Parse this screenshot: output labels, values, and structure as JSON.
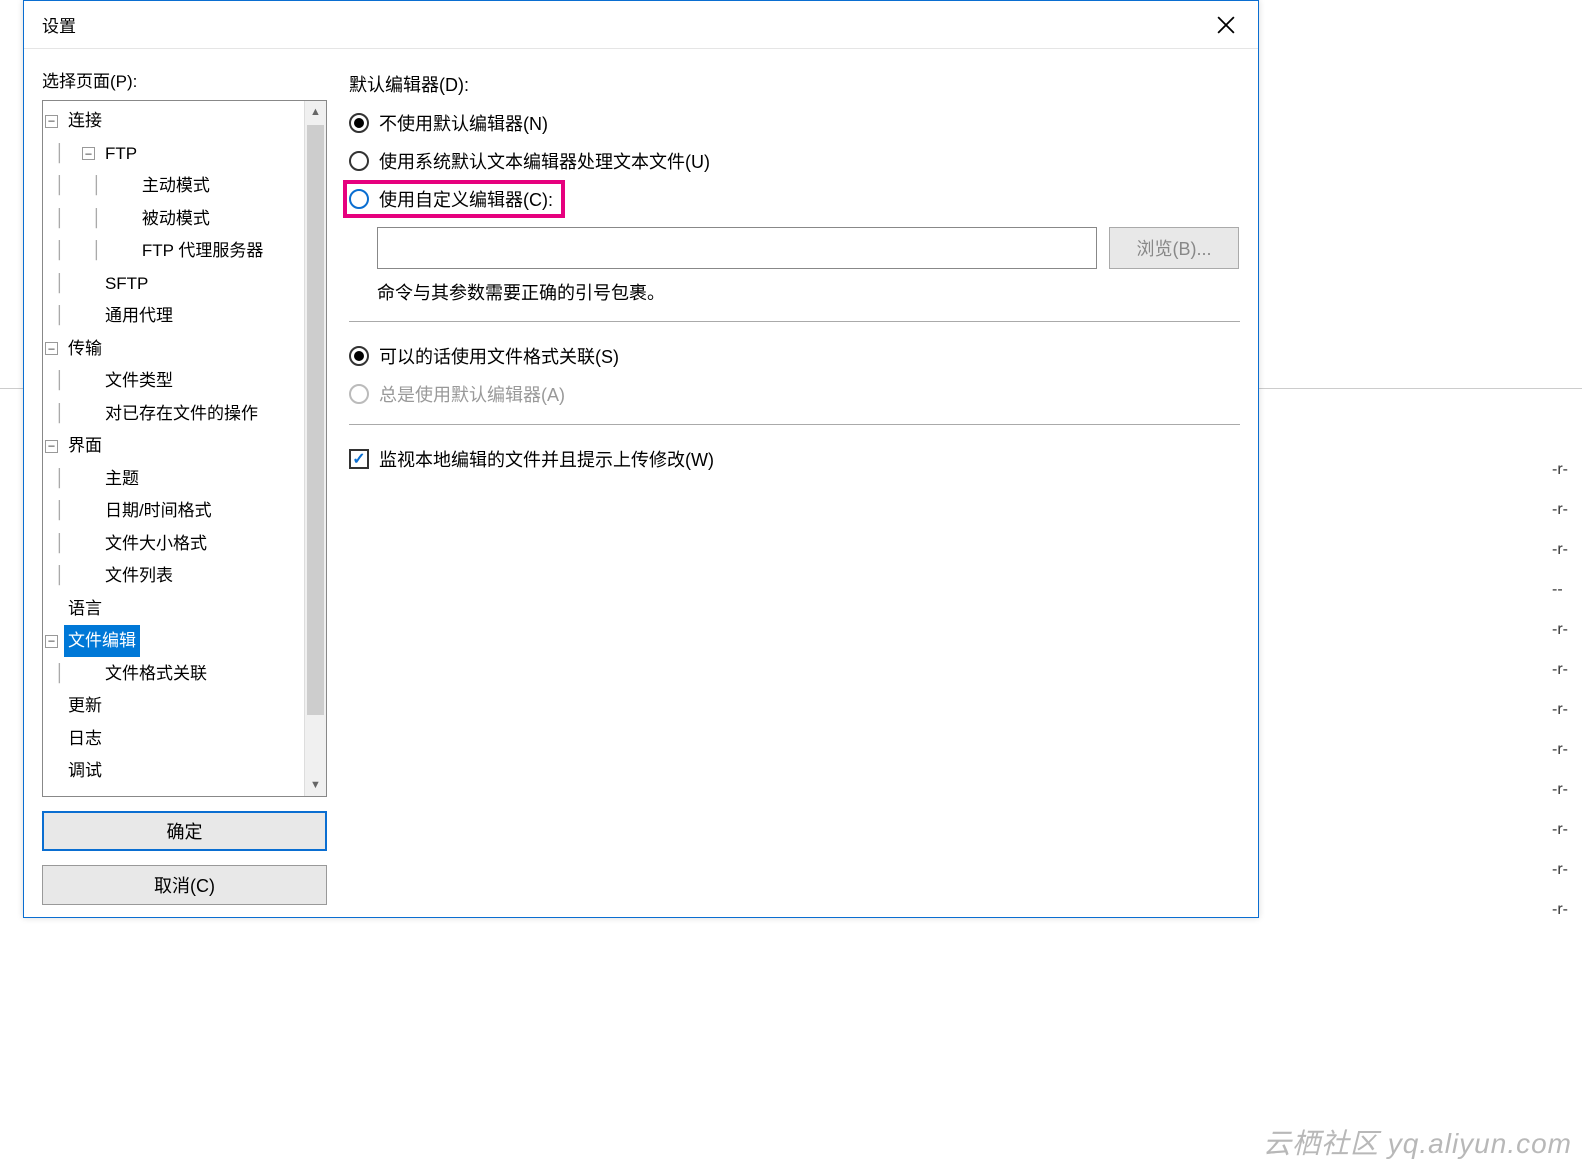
{
  "dialog": {
    "title": "设置",
    "select_page_label": "选择页面(P):",
    "ok_label": "确定",
    "cancel_label": "取消(C)"
  },
  "tree": {
    "items": [
      {
        "label": "连接",
        "depth": 0,
        "exp": "-"
      },
      {
        "label": "FTP",
        "depth": 1,
        "exp": "-"
      },
      {
        "label": "主动模式",
        "depth": 2,
        "exp": ""
      },
      {
        "label": "被动模式",
        "depth": 2,
        "exp": ""
      },
      {
        "label": "FTP 代理服务器",
        "depth": 2,
        "exp": ""
      },
      {
        "label": "SFTP",
        "depth": 1,
        "exp": ""
      },
      {
        "label": "通用代理",
        "depth": 1,
        "exp": ""
      },
      {
        "label": "传输",
        "depth": 0,
        "exp": "-"
      },
      {
        "label": "文件类型",
        "depth": 1,
        "exp": ""
      },
      {
        "label": "对已存在文件的操作",
        "depth": 1,
        "exp": ""
      },
      {
        "label": "界面",
        "depth": 0,
        "exp": "-"
      },
      {
        "label": "主题",
        "depth": 1,
        "exp": ""
      },
      {
        "label": "日期/时间格式",
        "depth": 1,
        "exp": ""
      },
      {
        "label": "文件大小格式",
        "depth": 1,
        "exp": ""
      },
      {
        "label": "文件列表",
        "depth": 1,
        "exp": ""
      },
      {
        "label": "语言",
        "depth": 0,
        "exp": ""
      },
      {
        "label": "文件编辑",
        "depth": 0,
        "exp": "-",
        "selected": true
      },
      {
        "label": "文件格式关联",
        "depth": 1,
        "exp": ""
      },
      {
        "label": "更新",
        "depth": 0,
        "exp": ""
      },
      {
        "label": "日志",
        "depth": 0,
        "exp": ""
      },
      {
        "label": "调试",
        "depth": 0,
        "exp": ""
      }
    ]
  },
  "editor": {
    "section_label": "默认编辑器(D):",
    "opt_none": "不使用默认编辑器(N)",
    "opt_system": "使用系统默认文本编辑器处理文本文件(U)",
    "opt_custom": "使用自定义编辑器(C):",
    "browse_label": "浏览(B)...",
    "hint": "命令与其参数需要正确的引号包裹。",
    "opt_assoc": "可以的话使用文件格式关联(S)",
    "opt_always": "总是使用默认编辑器(A)",
    "watch_label": "监视本地编辑的文件并且提示上传修改(W)"
  },
  "watermark": "云栖社区 yq.aliyun.com",
  "bg_rows": [
    "-r-",
    "-r-",
    "-r-",
    "--",
    "-r-",
    "-r-",
    "-r-",
    "-r-",
    "-r-",
    "-r-",
    "-r-",
    "-r-"
  ]
}
